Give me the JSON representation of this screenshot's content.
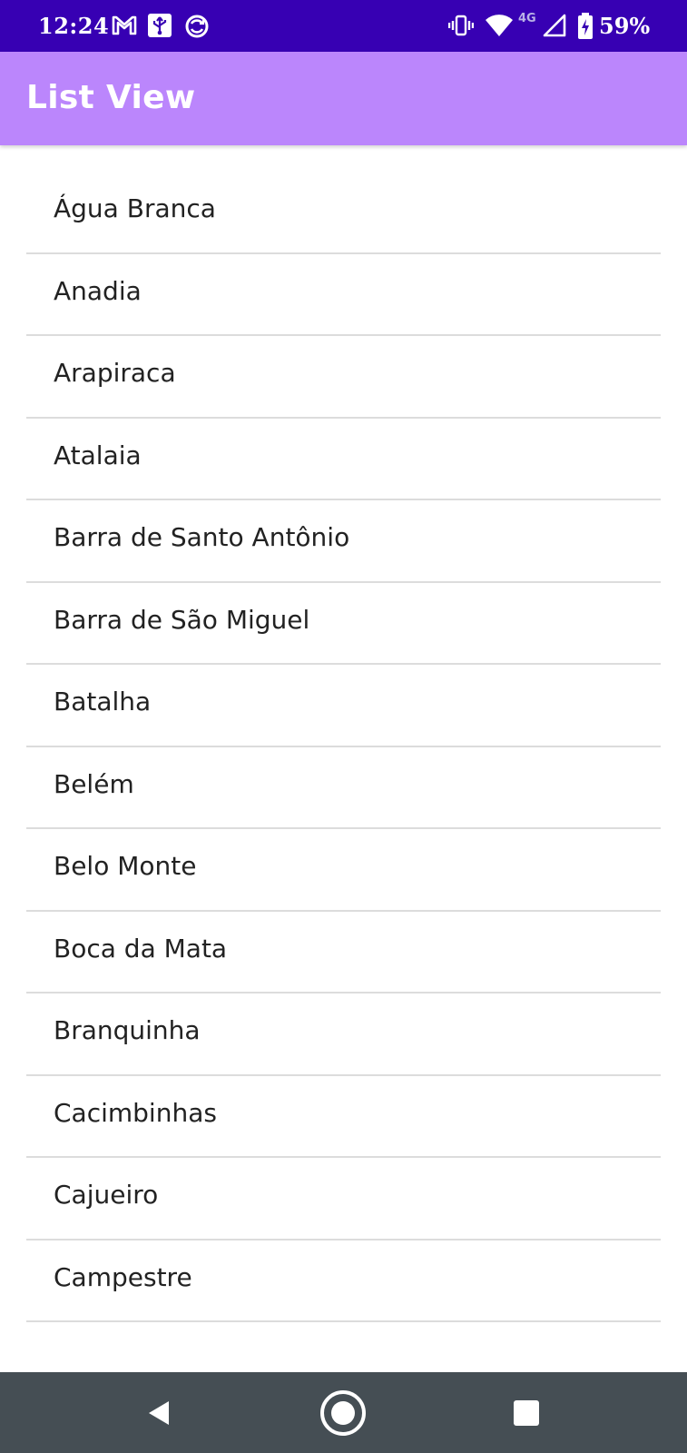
{
  "status_bar": {
    "time": "12:24",
    "network_type": "4G",
    "battery": "59%",
    "icons": [
      "gmail-icon",
      "usb-icon",
      "sync-icon",
      "vibrate-icon",
      "wifi-icon",
      "signal-icon",
      "battery-charging-icon"
    ]
  },
  "app_bar": {
    "title": "List View",
    "color": "#bb86fc"
  },
  "list": {
    "items": [
      "Água Branca",
      "Anadia",
      "Arapiraca",
      "Atalaia",
      "Barra de Santo Antônio",
      "Barra de São Miguel",
      "Batalha",
      "Belém",
      "Belo Monte",
      "Boca da Mata",
      "Branquinha",
      "Cacimbinhas",
      "Cajueiro",
      "Campestre"
    ]
  },
  "nav_bar": {
    "buttons": [
      "back-icon",
      "home-icon",
      "recents-icon"
    ]
  }
}
